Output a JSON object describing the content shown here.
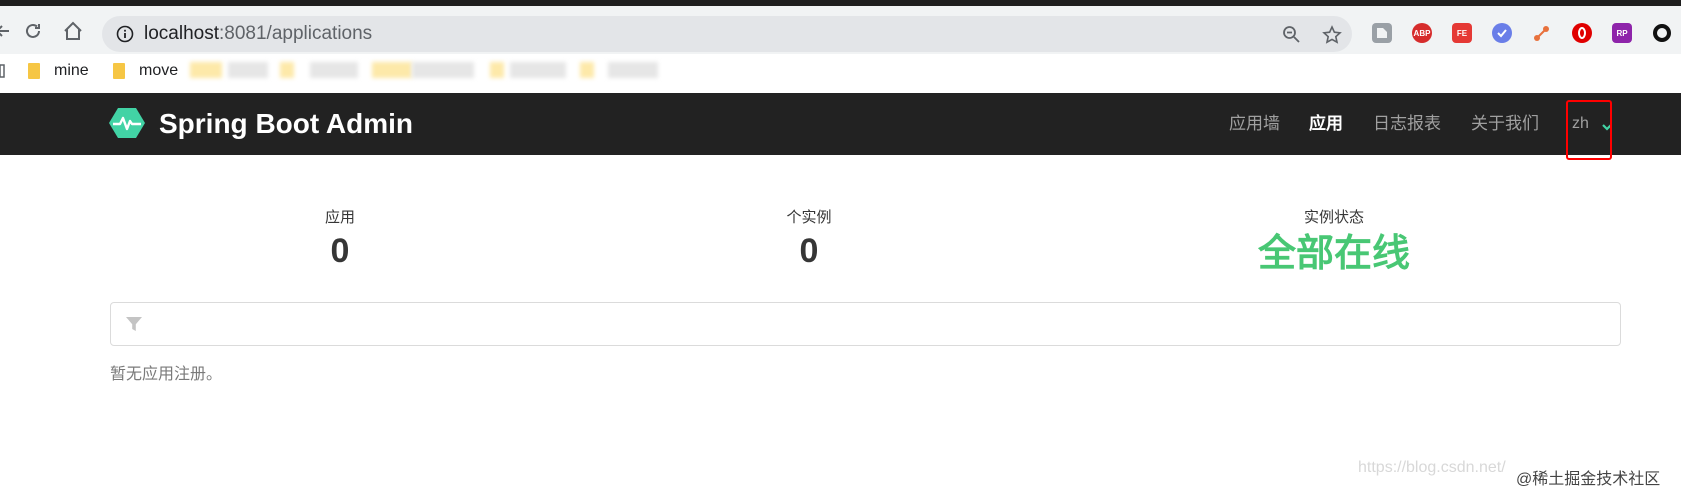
{
  "browser": {
    "url_host": "localhost",
    "url_path": ":8081/applications",
    "bookmarks": [
      "mine",
      "move"
    ],
    "icons": [
      "back-icon",
      "reload-icon",
      "home-icon",
      "info-icon",
      "zoom-out-icon",
      "star-icon"
    ],
    "extensions": [
      "ABP",
      "FE",
      "RP"
    ]
  },
  "app": {
    "brand": "Spring Boot Admin",
    "brand_color": "#42d3a5",
    "nav": {
      "wallboard": "应用墙",
      "applications": "应用",
      "journal": "日志报表",
      "about": "关于我们",
      "language": "zh"
    }
  },
  "stats": {
    "applications_label": "应用",
    "applications_value": "0",
    "instances_label": "个实例",
    "instances_value": "0",
    "status_label": "实例状态",
    "status_value": "全部在线",
    "status_color": "#48c774"
  },
  "filter": {
    "placeholder": ""
  },
  "empty_message": "暂无应用注册。",
  "watermark": {
    "blog": "https://blog.csdn.net/",
    "community": "@稀土掘金技术社区"
  }
}
